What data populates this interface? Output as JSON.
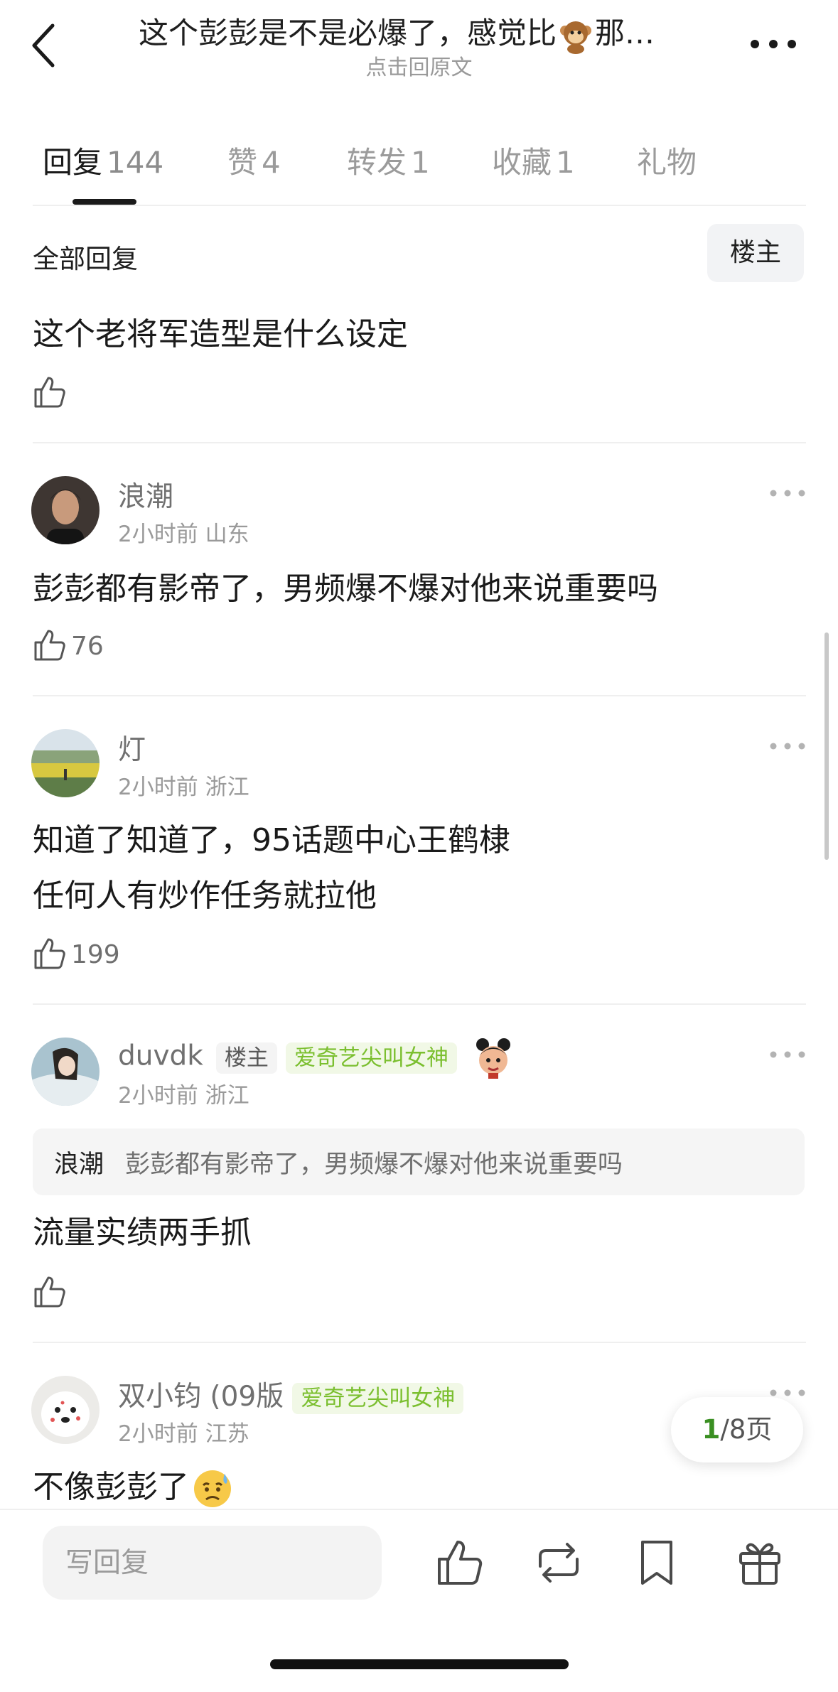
{
  "header": {
    "title": "这个彭彭是不是必爆了，感觉比",
    "title_tail": "那…",
    "subtitle": "点击回原文"
  },
  "tabs": [
    {
      "label": "回复",
      "count": "144"
    },
    {
      "label": "赞",
      "count": "4"
    },
    {
      "label": "转发",
      "count": "1"
    },
    {
      "label": "收藏",
      "count": "1"
    },
    {
      "label": "礼物",
      "count": ""
    }
  ],
  "filter": {
    "all_replies": "全部回复",
    "op_only": "楼主"
  },
  "top_post": {
    "text": "这个老将军造型是什么设定"
  },
  "comments": [
    {
      "username": "浪潮",
      "time": "2小时前",
      "location": "山东",
      "text": "彭彭都有影帝了，男频爆不爆对他来说重要吗",
      "likes": "76"
    },
    {
      "username": "灯",
      "time": "2小时前",
      "location": "浙江",
      "text_line1": "知道了知道了，95话题中心王鹤棣",
      "text_line2": "任何人有炒作任务就拉他",
      "likes": "199"
    },
    {
      "username": "duvdk",
      "op_badge": "楼主",
      "title_badge": "爱奇艺尖叫女神",
      "time": "2小时前",
      "location": "浙江",
      "quote_user": "浪潮",
      "quote_text": "彭彭都有影帝了，男频爆不爆对他来说重要吗",
      "text": "流量实绩两手抓",
      "likes": ""
    },
    {
      "username": "双小钧 (09版",
      "title_badge": "爱奇艺尖叫女神",
      "time": "2小时前",
      "location": "江苏",
      "text": "不像彭彭了"
    }
  ],
  "pager": {
    "current": "1",
    "total": "/8页"
  },
  "bottom": {
    "reply_placeholder": "写回复"
  },
  "colors": {
    "accent_green": "#7bbf2f",
    "pager_green": "#3a8f22",
    "separator": "#efefef"
  }
}
